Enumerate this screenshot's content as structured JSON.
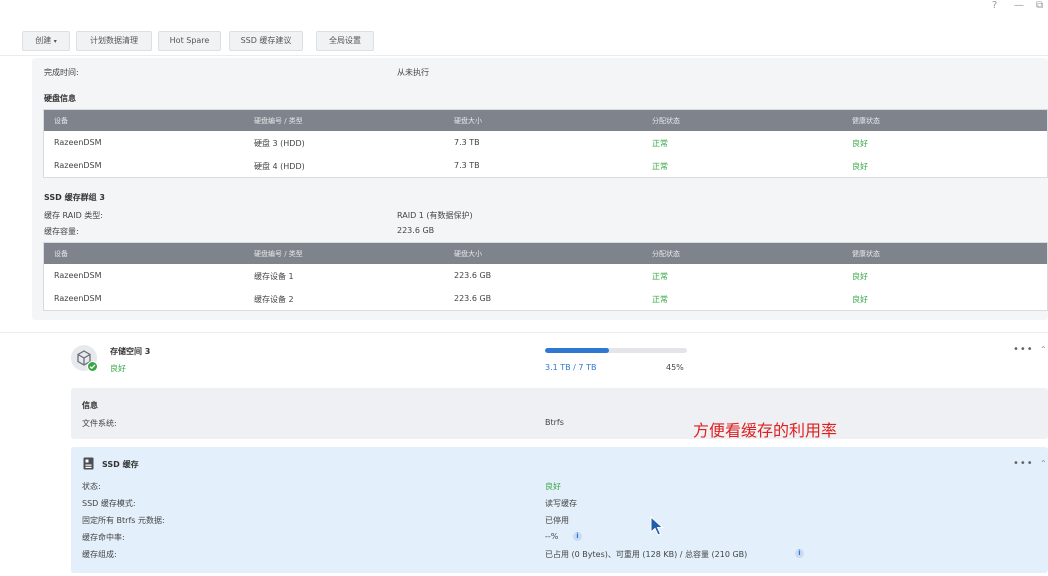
{
  "window": {
    "help": "?",
    "minimize": "—",
    "restore": "⧉"
  },
  "toolbar": {
    "create": "创建",
    "scheduled": "计划数据清理",
    "hotspare": "Hot Spare",
    "ssd_advice": "SSD 缓存建议",
    "global": "全局设置"
  },
  "top": {
    "finish_label": "完成时间:",
    "finish_value": "从未执行",
    "disk_info_heading": "硬盘信息",
    "ssd_group_heading": "SSD 缓存群组 3",
    "raid_label": "缓存 RAID 类型:",
    "raid_value": "RAID 1 (有数据保护)",
    "cap_label": "缓存容量:",
    "cap_value": "223.6 GB"
  },
  "columns": [
    "设备",
    "硬盘编号 / 类型",
    "硬盘大小",
    "分配状态",
    "健康状态"
  ],
  "disks": [
    {
      "device": "RazeenDSM",
      "id": "硬盘 3 (HDD)",
      "size": "7.3 TB",
      "alloc": "正常",
      "health": "良好"
    },
    {
      "device": "RazeenDSM",
      "id": "硬盘 4 (HDD)",
      "size": "7.3 TB",
      "alloc": "正常",
      "health": "良好"
    }
  ],
  "cache_disks": [
    {
      "device": "RazeenDSM",
      "id": "缓存设备 1",
      "size": "223.6 GB",
      "alloc": "正常",
      "health": "良好"
    },
    {
      "device": "RazeenDSM",
      "id": "缓存设备 2",
      "size": "223.6 GB",
      "alloc": "正常",
      "health": "良好"
    }
  ],
  "volume": {
    "name": "存储空间 3",
    "status": "良好",
    "usage": "3.1 TB / 7 TB",
    "percent": "45%",
    "usage_fraction": 0.45,
    "menu": "•••",
    "collapse": "⌃"
  },
  "info": {
    "heading": "信息",
    "fs_label": "文件系统:",
    "fs_value": "Btrfs"
  },
  "ssd": {
    "heading": "SSD 缓存",
    "menu": "•••",
    "collapse": "⌃",
    "status_label": "状态:",
    "status_value": "良好",
    "mode_label": "SSD 缓存模式:",
    "mode_value": "读写缓存",
    "pin_label": "固定所有 Btrfs 元数据:",
    "pin_value": "已停用",
    "hit_label": "缓存命中率:",
    "hit_value": "--%",
    "comp_label": "缓存组成:",
    "comp_value": "已占用 (0 Bytes)、可重用 (128 KB) / 总容量 (210 GB)",
    "info_glyph": "i"
  },
  "annotation": "方便看缓存的利用率",
  "colors": {
    "ok": "#35a745",
    "accent": "#2f78d2",
    "annotation": "#e02020"
  }
}
